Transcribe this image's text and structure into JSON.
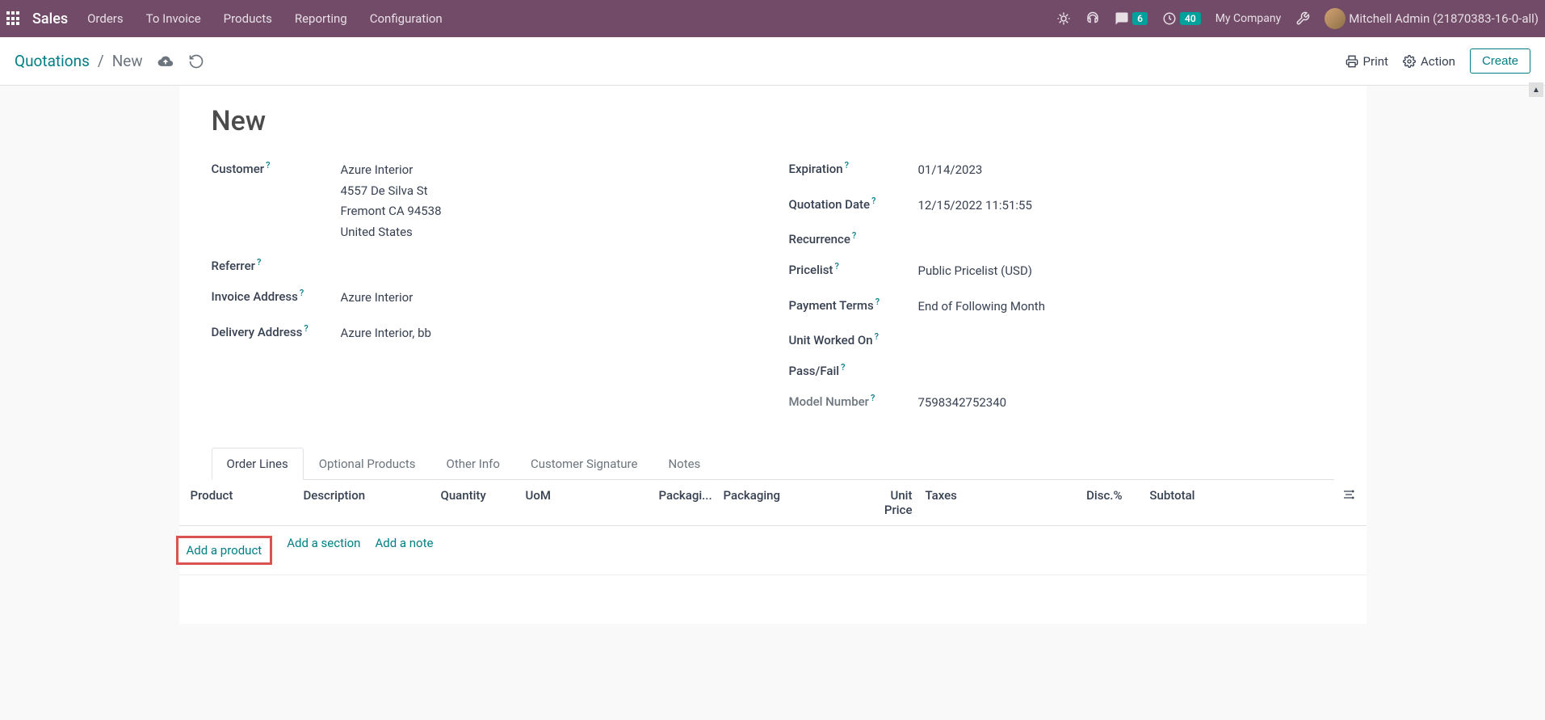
{
  "navbar": {
    "brand": "Sales",
    "menu": [
      "Orders",
      "To Invoice",
      "Products",
      "Reporting",
      "Configuration"
    ],
    "chat_badge": "6",
    "clock_badge": "40",
    "company": "My Company",
    "user": "Mitchell Admin (21870383-16-0-all)"
  },
  "toolbar": {
    "breadcrumb_root": "Quotations",
    "breadcrumb_current": "New",
    "print_label": "Print",
    "action_label": "Action",
    "create_label": "Create"
  },
  "form": {
    "title": "New",
    "left": {
      "customer_label": "Customer",
      "customer_name": "Azure Interior",
      "customer_addr1": "4557 De Silva St",
      "customer_addr2": "Fremont CA 94538",
      "customer_country": "United States",
      "referrer_label": "Referrer",
      "invoice_addr_label": "Invoice Address",
      "invoice_addr_value": "Azure Interior",
      "delivery_addr_label": "Delivery Address",
      "delivery_addr_value": "Azure Interior, bb"
    },
    "right": {
      "expiration_label": "Expiration",
      "expiration_value": "01/14/2023",
      "quotation_date_label": "Quotation Date",
      "quotation_date_value": "12/15/2022 11:51:55",
      "recurrence_label": "Recurrence",
      "pricelist_label": "Pricelist",
      "pricelist_value": "Public Pricelist (USD)",
      "payment_terms_label": "Payment Terms",
      "payment_terms_value": "End of Following Month",
      "unit_worked_label": "Unit Worked On",
      "passfail_label": "Pass/Fail",
      "model_label": "Model Number",
      "model_value": "7598342752340"
    }
  },
  "tabs": [
    "Order Lines",
    "Optional Products",
    "Other Info",
    "Customer Signature",
    "Notes"
  ],
  "table": {
    "headers": {
      "product": "Product",
      "description": "Description",
      "quantity": "Quantity",
      "uom": "UoM",
      "packaging1": "Packagi...",
      "packaging2": "Packaging",
      "unitprice": "Unit Price",
      "taxes": "Taxes",
      "disc": "Disc.%",
      "subtotal": "Subtotal"
    },
    "add_product": "Add a product",
    "add_section": "Add a section",
    "add_note": "Add a note"
  }
}
